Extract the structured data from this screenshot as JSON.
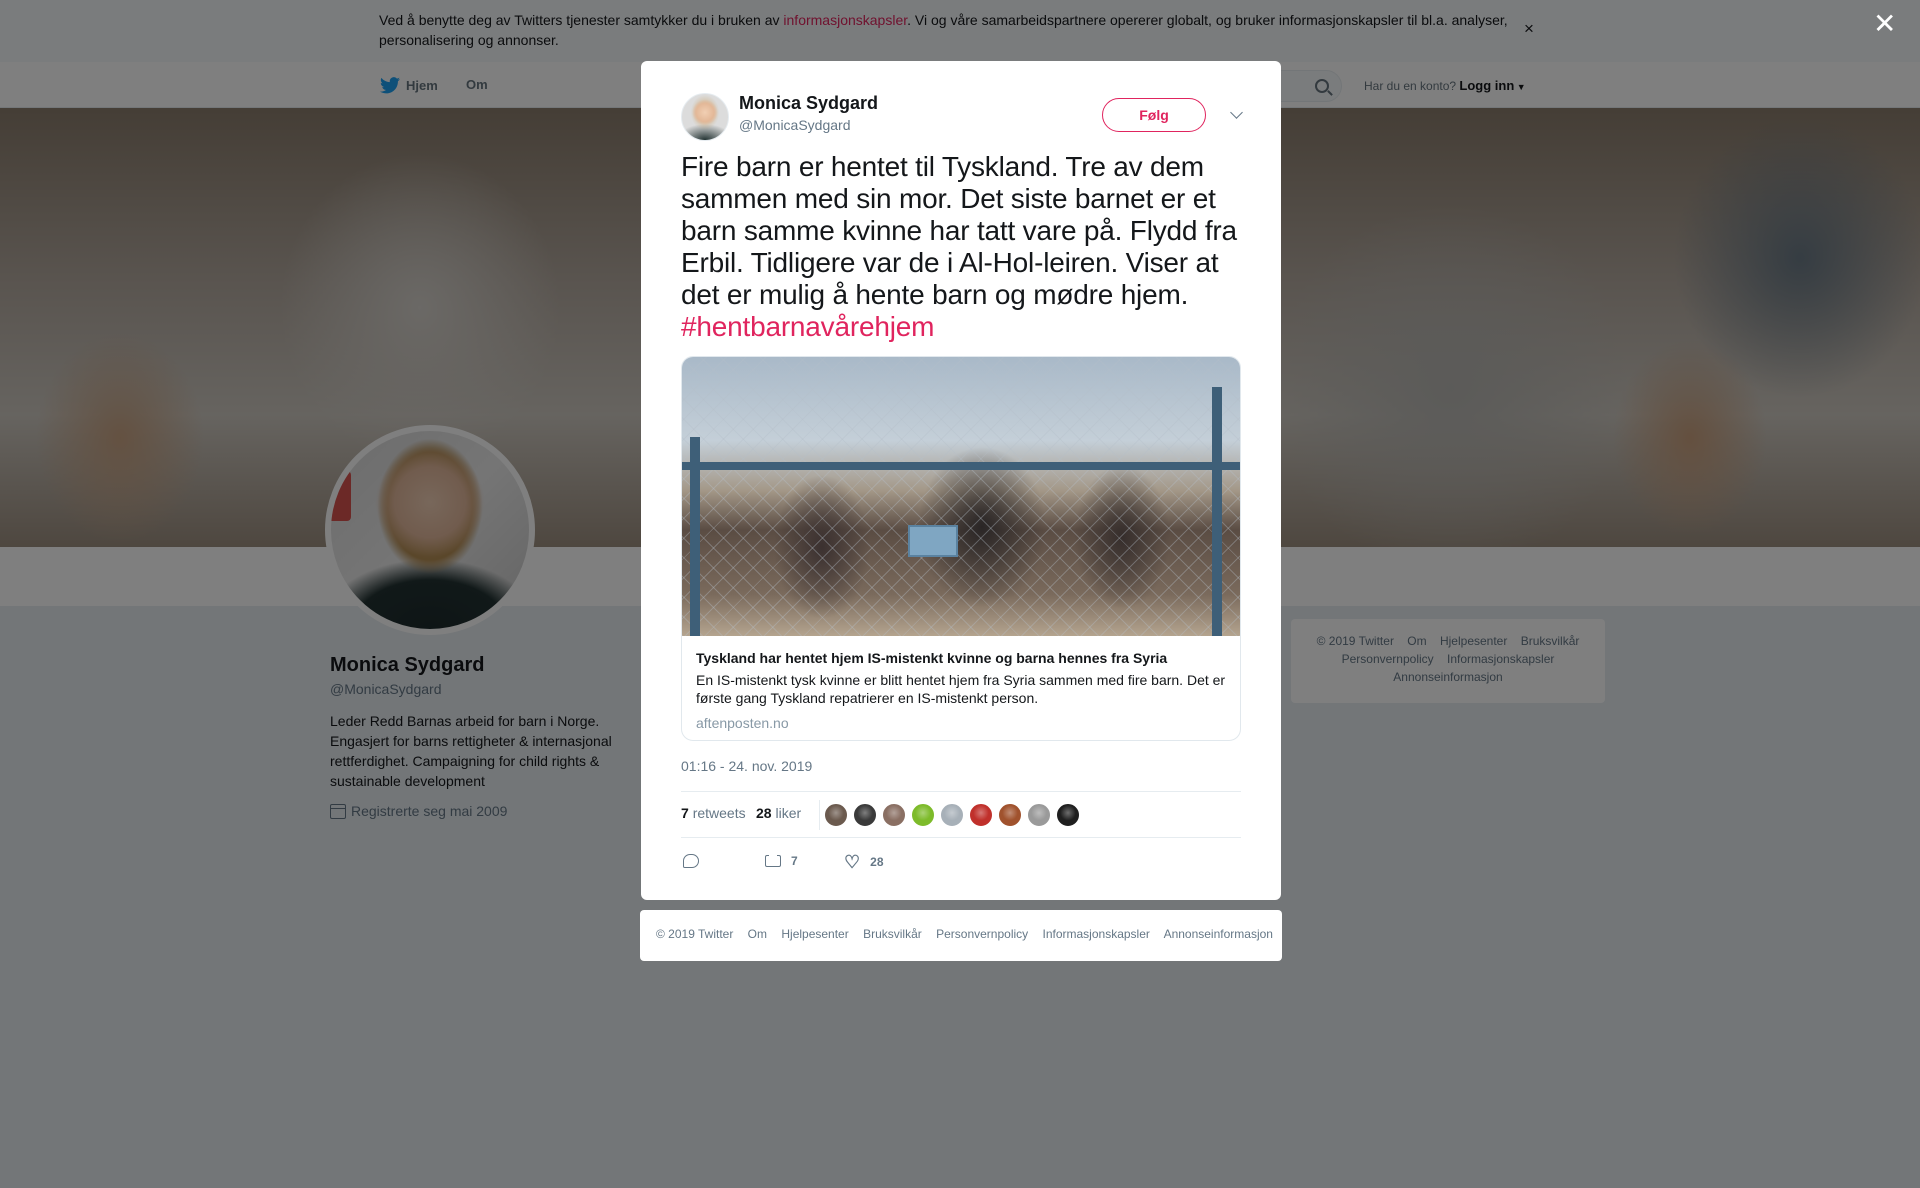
{
  "cookie_banner": {
    "text_before": "Ved å benytte deg av Twitters tjenester samtykker du i bruken av ",
    "link": "informasjonskapsler",
    "text_after": ". Vi og våre samarbeidspartnere opererer globalt, og bruker informasjonskapsler til bl.a. analyser, personalisering og annonser.",
    "close": "×"
  },
  "topnav": {
    "home": "Hjem",
    "about": "Om",
    "account_question": "Har du en konto?",
    "login": "Logg inn"
  },
  "profile": {
    "name": "Monica Sydgard",
    "handle": "@MonicaSydgard",
    "bio": "Leder Redd Barnas arbeid for barn i Norge. Engasjert for barns rettigheter & internasjonal rettferdighet. Campaigning for child rights & sustainable development",
    "joined": "Registrerte seg mai 2009"
  },
  "side_footer": {
    "items": [
      "© 2019 Twitter",
      "Om",
      "Hjelpesenter",
      "Bruksvilkår",
      "Personvernpolicy",
      "Informasjonskapsler",
      "Annonseinformasjon"
    ]
  },
  "overlay": {
    "close": "✕"
  },
  "tweet": {
    "author_name": "Monica Sydgard",
    "author_handle": "@MonicaSydgard",
    "follow_label": "Følg",
    "text": "Fire barn er hentet til Tyskland. Tre av dem sammen med sin mor. Det siste barnet er et barn samme kvinne har tatt vare på. Flydd fra Erbil. Tidligere var de i Al-Hol-leiren. Viser at det er mulig å hente barn og mødre hjem.",
    "hashtag": "#hentbarnavårehjem",
    "card": {
      "title": "Tyskland har hentet hjem IS-mistenkt kvinne og barna hennes fra Syria",
      "description": "En IS-mistenkt tysk kvinne er blitt hentet hjem fra Syria sammen med fire barn. Det er første gang Tyskland repatrierer en IS-mistenkt person.",
      "domain": "aftenposten.no"
    },
    "timestamp": "01:16 - 24. nov. 2019",
    "retweets_count": "7",
    "retweets_label": "retweets",
    "likes_count": "28",
    "likes_label": "liker",
    "likers": [
      "#6b5a4e",
      "#3a3a3a",
      "#8a6f63",
      "#7dbb2a",
      "#a7b0b8",
      "#c0302b",
      "#a0522d",
      "#9a9a9a",
      "#1f1f1f"
    ],
    "action_retweets": "7",
    "action_likes": "28"
  },
  "modal_footer": {
    "items": [
      "© 2019 Twitter",
      "Om",
      "Hjelpesenter",
      "Bruksvilkår",
      "Personvernpolicy",
      "Informasjonskapsler",
      "Annonseinformasjon"
    ]
  },
  "colors": {
    "accent": "#e0245e",
    "muted": "#657786",
    "overlay": "rgba(0,0,0,0.5)"
  }
}
